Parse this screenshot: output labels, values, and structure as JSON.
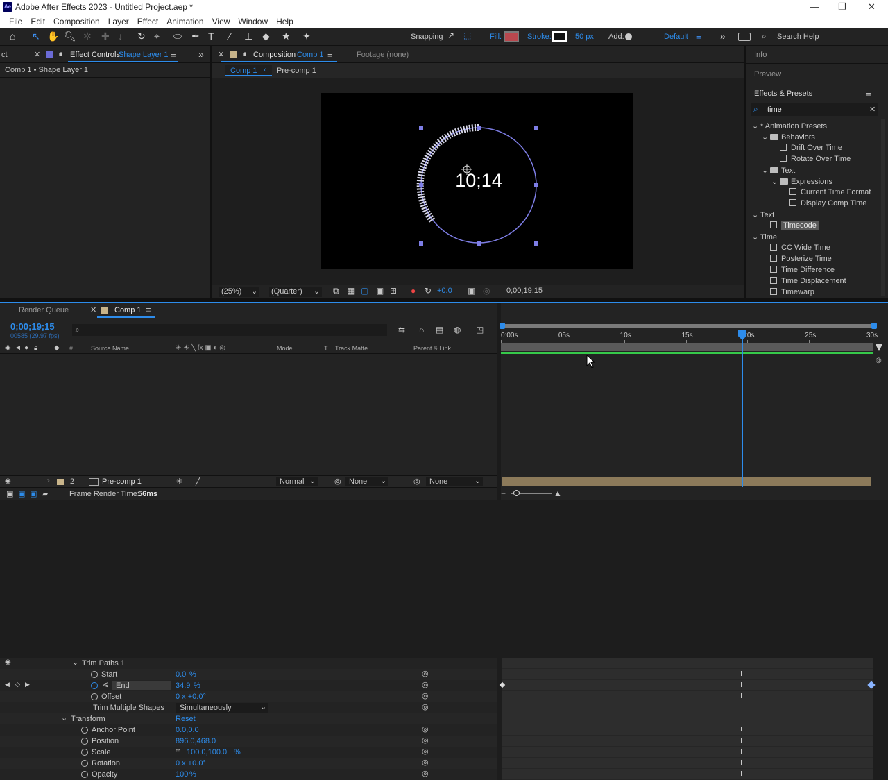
{
  "window": {
    "title": "Adobe After Effects 2023 - Untitled Project.aep *",
    "logo": "Ae",
    "minimize_icon": "minimize-icon",
    "maximize_icon": "restore-icon",
    "close_icon": "close-icon"
  },
  "menu": [
    "File",
    "Edit",
    "Composition",
    "Layer",
    "Effect",
    "Animation",
    "View",
    "Window",
    "Help"
  ],
  "toolbar": {
    "snapping_label": "Snapping",
    "fill_label": "Fill:",
    "stroke_label": "Stroke:",
    "stroke_width": "50 px",
    "add_label": "Add:",
    "workspace": "Default",
    "search_help": "Search Help",
    "fill_color": "#b8484e"
  },
  "left_panel": {
    "tab_fragment": "ct",
    "tab_label": "Effect Controls",
    "tab_layer": "Shape Layer 1",
    "header": "Comp 1 • Shape Layer 1"
  },
  "composition_panel": {
    "tab_label": "Composition",
    "tab_comp": "Comp 1",
    "footage_label": "Footage (none)",
    "breadcrumb_1": "Comp 1",
    "breadcrumb_2": "Pre-comp 1",
    "timecode_text": "10;14",
    "zoom": "(25%)",
    "resolution": "(Quarter)",
    "exposure": "+0.0",
    "current_time": "0;00;19;15"
  },
  "right_panel": {
    "info": "Info",
    "preview": "Preview",
    "effects_title": "Effects & Presets",
    "search_value": "time",
    "tree": [
      {
        "label": "* Animation Presets",
        "indent": 0,
        "kind": "group"
      },
      {
        "label": "Behaviors",
        "indent": 1,
        "kind": "folder"
      },
      {
        "label": "Drift Over Time",
        "indent": 2,
        "kind": "preset"
      },
      {
        "label": "Rotate Over Time",
        "indent": 2,
        "kind": "preset"
      },
      {
        "label": "Text",
        "indent": 1,
        "kind": "folder"
      },
      {
        "label": "Expressions",
        "indent": 2,
        "kind": "folder"
      },
      {
        "label": "Current Time Format",
        "indent": 3,
        "kind": "preset"
      },
      {
        "label": "Display Comp Time",
        "indent": 3,
        "kind": "preset"
      },
      {
        "label": "Text",
        "indent": 0,
        "kind": "group"
      },
      {
        "label": "Timecode",
        "indent": 1,
        "kind": "effect",
        "selected": true
      },
      {
        "label": "Time",
        "indent": 0,
        "kind": "group"
      },
      {
        "label": "CC Wide Time",
        "indent": 1,
        "kind": "effect"
      },
      {
        "label": "Posterize Time",
        "indent": 1,
        "kind": "effect"
      },
      {
        "label": "Time Difference",
        "indent": 1,
        "kind": "effect"
      },
      {
        "label": "Time Displacement",
        "indent": 1,
        "kind": "effect"
      },
      {
        "label": "Timewarp",
        "indent": 1,
        "kind": "effect"
      }
    ]
  },
  "timeline": {
    "render_queue": "Render Queue",
    "comp_tab": "Comp 1",
    "timecode": "0;00;19;15",
    "fps": "00585 (29.97 fps)",
    "columns": {
      "hash": "#",
      "source": "Source Name",
      "mode": "Mode",
      "t": "T",
      "track_matte": "Track Matte",
      "parent": "Parent & Link"
    },
    "ruler": [
      "0:00s",
      "05s",
      "10s",
      "15s",
      "20s",
      "25s",
      "30s"
    ],
    "properties": [
      {
        "name": "Trim Paths 1",
        "value": "",
        "indent": 1,
        "twirl": true,
        "stopwatch": false
      },
      {
        "name": "Start",
        "value": "0.0",
        "unit": "%",
        "indent": 2,
        "stopwatch": true
      },
      {
        "name": "End",
        "value": "34.9",
        "unit": "%",
        "indent": 2,
        "stopwatch": true,
        "selected": true
      },
      {
        "name": "Offset",
        "value": "0 x +0.0°",
        "unit": "",
        "indent": 2,
        "stopwatch": true
      },
      {
        "name": "Trim Multiple Shapes",
        "value": "Simultaneously",
        "unit": "",
        "indent": 2,
        "stopwatch": false,
        "dropdown": true
      },
      {
        "name": "Transform",
        "value": "Reset",
        "indent": 0,
        "twirl": true,
        "stopwatch": false
      },
      {
        "name": "Anchor Point",
        "value": "0.0,0.0",
        "unit": "",
        "indent": 1,
        "stopwatch": true
      },
      {
        "name": "Position",
        "value": "896.0,468.0",
        "unit": "",
        "indent": 1,
        "stopwatch": true
      },
      {
        "name": "Scale",
        "value": "100.0,100.0",
        "unit": "%",
        "indent": 1,
        "stopwatch": true,
        "link": true
      },
      {
        "name": "Rotation",
        "value": "0 x +0.0°",
        "unit": "",
        "indent": 1,
        "stopwatch": true
      },
      {
        "name": "Opacity",
        "value": "100",
        "unit": "%",
        "indent": 1,
        "stopwatch": true
      }
    ],
    "layer2": {
      "index": "2",
      "name": "Pre-comp 1",
      "mode": "Normal",
      "track_matte": "None",
      "parent": "None"
    },
    "render_time_label": "Frame Render Time:",
    "render_time_value": "56ms"
  },
  "colors": {
    "accent_blue": "#2d8ceb",
    "selection_purple": "#6b6bd6",
    "work_area_green": "#36c94a",
    "layer_bar": "#8c7a5a"
  }
}
